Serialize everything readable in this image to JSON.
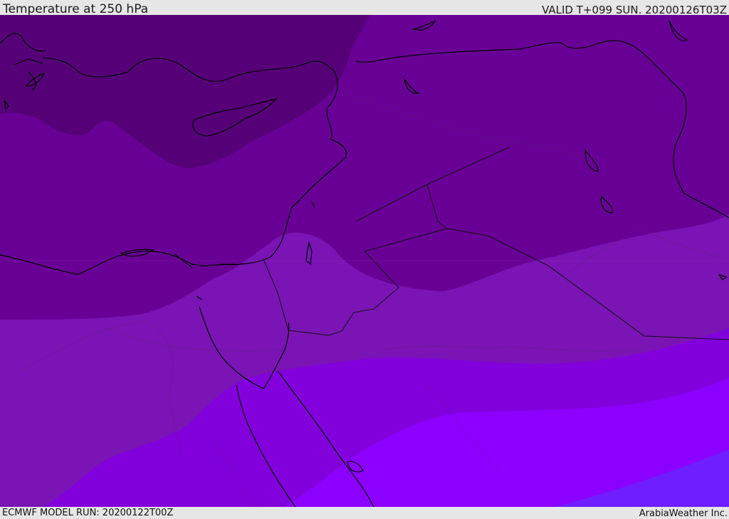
{
  "header": {
    "title": "Temperature at 250 hPa",
    "valid": "VALID T+099 SUN. 20200126T03Z"
  },
  "footer": {
    "model_run": "ECMWF MODEL RUN: 20200122T00Z",
    "credit": "ArabiaWeather Inc."
  },
  "map": {
    "field": "temperature",
    "pressure_level": "250 hPa",
    "region": "Eastern Mediterranean / Middle East",
    "legend": "none",
    "colors": {
      "band_coldest": "#560078",
      "band_cold": "#690096",
      "band_mid": "#7a14b4",
      "band_warm": "#8200dc",
      "band_warmer": "#8c00ff",
      "band_warmest": "#6e1eff",
      "coastline": "#000000",
      "borders": "#1a1a1a"
    }
  }
}
